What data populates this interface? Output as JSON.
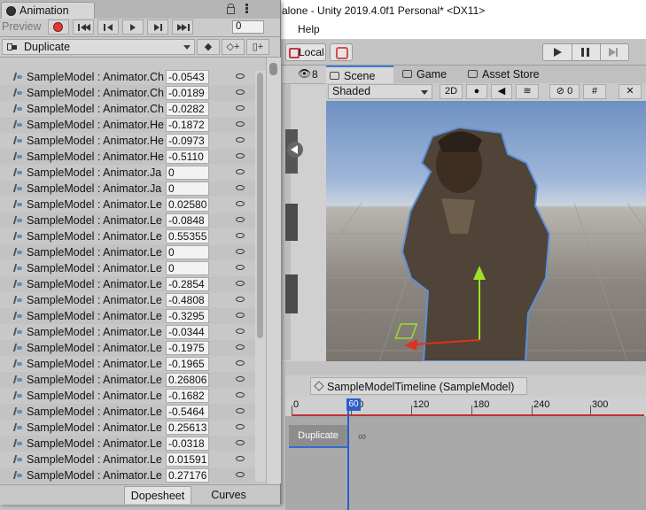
{
  "unity": {
    "title": "alone - Unity 2019.4.0f1 Personal* <DX11>",
    "menu_help": "Help",
    "local_label": "Local"
  },
  "scene": {
    "tabs": [
      {
        "label": "Scene",
        "icon": "hash-icon",
        "active": true
      },
      {
        "label": "Game",
        "icon": "gamepad-icon",
        "active": false
      },
      {
        "label": "Asset Store",
        "icon": "store-bag-icon",
        "active": false
      }
    ],
    "shading": "Shaded",
    "mode_2d": "2D",
    "hidden_count": "0",
    "layers_count": "8"
  },
  "timeline": {
    "breadcrumb": "SampleModelTimeline (SampleModel)",
    "ticks": [
      "0",
      "60",
      "120",
      "180",
      "240",
      "300"
    ],
    "clip_label": "Duplicate",
    "playhead_frame": "60"
  },
  "animation": {
    "tab_label": "Animation",
    "preview_label": "Preview",
    "frame_value": "0",
    "clip_name": "Duplicate",
    "bottom_tabs": {
      "dopesheet": "Dopesheet",
      "curves": "Curves"
    },
    "properties": [
      {
        "name": "SampleModel : Animator.Ch",
        "value": "-0.0543"
      },
      {
        "name": "SampleModel : Animator.Ch",
        "value": "-0.0189"
      },
      {
        "name": "SampleModel : Animator.Ch",
        "value": "-0.0282"
      },
      {
        "name": "SampleModel : Animator.He",
        "value": "-0.1872"
      },
      {
        "name": "SampleModel : Animator.He",
        "value": "-0.0973"
      },
      {
        "name": "SampleModel : Animator.He",
        "value": "-0.5110"
      },
      {
        "name": "SampleModel : Animator.Ja",
        "value": "0"
      },
      {
        "name": "SampleModel : Animator.Ja",
        "value": "0"
      },
      {
        "name": "SampleModel : Animator.Le",
        "value": "0.02580"
      },
      {
        "name": "SampleModel : Animator.Le",
        "value": "-0.0848"
      },
      {
        "name": "SampleModel : Animator.Le",
        "value": "0.55355"
      },
      {
        "name": "SampleModel : Animator.Le",
        "value": "0"
      },
      {
        "name": "SampleModel : Animator.Le",
        "value": "0"
      },
      {
        "name": "SampleModel : Animator.Le",
        "value": "-0.2854"
      },
      {
        "name": "SampleModel : Animator.Le",
        "value": "-0.4808"
      },
      {
        "name": "SampleModel : Animator.Le",
        "value": "-0.3295"
      },
      {
        "name": "SampleModel : Animator.Le",
        "value": "-0.0344"
      },
      {
        "name": "SampleModel : Animator.Le",
        "value": "-0.1975"
      },
      {
        "name": "SampleModel : Animator.Le",
        "value": "-0.1965"
      },
      {
        "name": "SampleModel : Animator.Le",
        "value": "0.26806"
      },
      {
        "name": "SampleModel : Animator.Le",
        "value": "-0.1682"
      },
      {
        "name": "SampleModel : Animator.Le",
        "value": "-0.5464"
      },
      {
        "name": "SampleModel : Animator.Le",
        "value": "0.25613"
      },
      {
        "name": "SampleModel : Animator.Le",
        "value": "-0.0318"
      },
      {
        "name": "SampleModel : Animator.Le",
        "value": "0.01591"
      },
      {
        "name": "SampleModel : Animator.Le",
        "value": "0.27176"
      }
    ]
  },
  "colors": {
    "accent": "#3d7bd9",
    "record": "#d83c3c",
    "playhead": "#2a5ec9"
  }
}
